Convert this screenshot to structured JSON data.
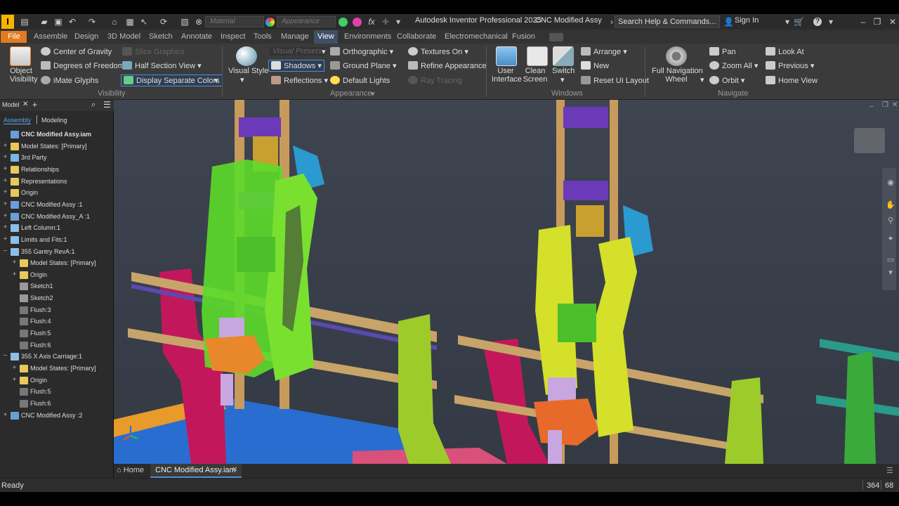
{
  "app": {
    "title": "Autodesk Inventor Professional 2025",
    "document": "CNC Modified Assy",
    "search_placeholder": "Search Help & Commands...",
    "sign_in": "Sign In"
  },
  "quick_access": {
    "material_placeholder": "Material",
    "appearance_placeholder": "Appearance"
  },
  "menu": {
    "items": [
      "File",
      "Assemble",
      "Design",
      "3D Model",
      "Sketch",
      "Annotate",
      "Inspect",
      "Tools",
      "Manage",
      "View",
      "Environments",
      "Collaborate",
      "Electromechanical",
      "Fusion"
    ],
    "active": "View"
  },
  "ribbon": {
    "visibility": {
      "label": "Visibility",
      "object_visibility": [
        "Object",
        "Visibility"
      ],
      "center_of_gravity": "Center of Gravity",
      "degrees_of_freedom": "Degrees of Freedom",
      "imate_glyphs": "iMate Glyphs",
      "slice_graphics": "Slice Graphics",
      "half_section_view": "Half Section View",
      "display_separate_colors": "Display Separate Colors"
    },
    "appearance": {
      "label": "Appearance",
      "visual_style": "Visual Style",
      "visual_presets": "Visual Presets",
      "shadows": "Shadows",
      "reflections": "Reflections",
      "orthographic": "Orthographic",
      "ground_plane": "Ground Plane",
      "default_lights": "Default Lights",
      "textures_on": "Textures On",
      "refine_appearance": "Refine Appearance",
      "ray_tracing": "Ray Tracing"
    },
    "windows": {
      "label": "Windows",
      "user_interface": [
        "User",
        "Interface"
      ],
      "clean_screen": [
        "Clean",
        "Screen"
      ],
      "switch": "Switch",
      "arrange": "Arrange",
      "new": "New",
      "reset_ui_layout": "Reset UI Layout"
    },
    "navigate": {
      "label": "Navigate",
      "full_navigation_wheel": [
        "Full Navigation",
        "Wheel"
      ],
      "pan": "Pan",
      "zoom_all": "Zoom All",
      "orbit": "Orbit",
      "look_at": "Look At",
      "previous": "Previous",
      "home_view": "Home View"
    }
  },
  "browser": {
    "title": "Model",
    "tabs": [
      "Assembly",
      "Modeling"
    ],
    "tree": [
      {
        "label": "CNC Modified Assy.iam",
        "level": 0,
        "exp": "",
        "icon": "assembly-icon"
      },
      {
        "label": "Model States: [Primary]",
        "level": 0,
        "exp": "+",
        "icon": "folder-icon"
      },
      {
        "label": "3rd Party",
        "level": 0,
        "exp": "+",
        "icon": "component-icon"
      },
      {
        "label": "Relationships",
        "level": 0,
        "exp": "+",
        "icon": "folder-icon"
      },
      {
        "label": "Representations",
        "level": 0,
        "exp": "+",
        "icon": "folder-icon"
      },
      {
        "label": "Origin",
        "level": 0,
        "exp": "+",
        "icon": "folder-icon"
      },
      {
        "label": "CNC Modified Assy :1",
        "level": 0,
        "exp": "+",
        "icon": "assembly-icon"
      },
      {
        "label": "CNC Modified Assy_A :1",
        "level": 0,
        "exp": "+",
        "icon": "assembly-icon"
      },
      {
        "label": "Left Column:1",
        "level": 0,
        "exp": "+",
        "icon": "part-icon"
      },
      {
        "label": "Limits and Fits:1",
        "level": 0,
        "exp": "+",
        "icon": "part-icon"
      },
      {
        "label": "355 Gantry RevA:1",
        "level": 0,
        "exp": "−",
        "icon": "part-icon"
      },
      {
        "label": "Model States: [Primary]",
        "level": 1,
        "exp": "+",
        "icon": "folder-icon"
      },
      {
        "label": "Origin",
        "level": 1,
        "exp": "+",
        "icon": "folder-icon"
      },
      {
        "label": "Sketch1",
        "level": 1,
        "exp": "",
        "icon": "sketch-icon"
      },
      {
        "label": "Sketch2",
        "level": 1,
        "exp": "",
        "icon": "sketch-icon"
      },
      {
        "label": "Flush:3",
        "level": 1,
        "exp": "",
        "icon": "constraint-icon"
      },
      {
        "label": "Flush:4",
        "level": 1,
        "exp": "",
        "icon": "constraint-icon"
      },
      {
        "label": "Flush:5",
        "level": 1,
        "exp": "",
        "icon": "constraint-icon"
      },
      {
        "label": "Flush:6",
        "level": 1,
        "exp": "",
        "icon": "constraint-icon"
      },
      {
        "label": "355 X Axis Carriage:1",
        "level": 0,
        "exp": "−",
        "icon": "part-icon"
      },
      {
        "label": "Model States: [Primary]",
        "level": 1,
        "exp": "+",
        "icon": "folder-icon"
      },
      {
        "label": "Origin",
        "level": 1,
        "exp": "+",
        "icon": "folder-icon"
      },
      {
        "label": "Flush:5",
        "level": 1,
        "exp": "",
        "icon": "constraint-icon"
      },
      {
        "label": "Flush:6",
        "level": 1,
        "exp": "",
        "icon": "constraint-icon"
      },
      {
        "label": "CNC Modified Assy :2",
        "level": 0,
        "exp": "+",
        "icon": "assembly-icon"
      }
    ]
  },
  "doc_tabs": {
    "home": "Home",
    "active": "CNC Modified Assy.iam"
  },
  "status": {
    "text": "Ready",
    "count_a": "364",
    "count_b": "68"
  },
  "colors": {
    "accent": "#e07b1f",
    "active_tab": "#3f4f66",
    "highlight": "#4d8fd6"
  }
}
